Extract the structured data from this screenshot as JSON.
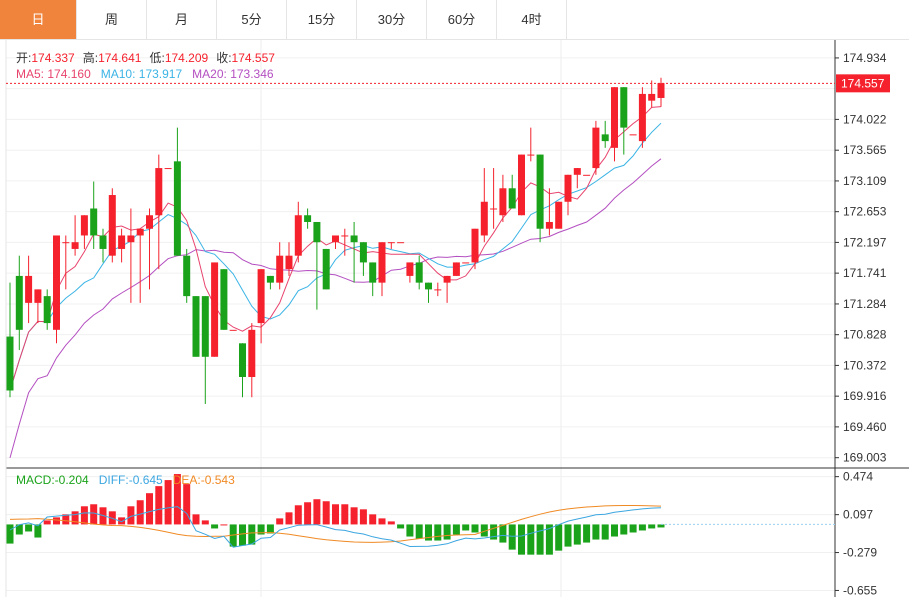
{
  "tabs": [
    {
      "label": "日",
      "active": true
    },
    {
      "label": "周",
      "active": false
    },
    {
      "label": "月",
      "active": false
    },
    {
      "label": "5分",
      "active": false
    },
    {
      "label": "15分",
      "active": false
    },
    {
      "label": "30分",
      "active": false
    },
    {
      "label": "60分",
      "active": false
    },
    {
      "label": "4时",
      "active": false
    }
  ],
  "ohlc_info": {
    "open_label": "开:",
    "open": "174.337",
    "high_label": "高:",
    "high": "174.641",
    "low_label": "低:",
    "low": "174.209",
    "close_label": "收:",
    "close": "174.557"
  },
  "ma_info": {
    "ma5_label": "MA5:",
    "ma5": "174.160",
    "ma10_label": "MA10:",
    "ma10": "173.917",
    "ma20_label": "MA20:",
    "ma20": "173.346"
  },
  "macd_info": {
    "macd_label": "MACD:",
    "macd": "-0.204",
    "diff_label": "DIFF:",
    "diff": "-0.645",
    "dea_label": "DEA:",
    "dea": "-0.543"
  },
  "colors": {
    "up": "#f5222d",
    "down": "#1aa31a",
    "ma5": "#e8436d",
    "ma10": "#3bb4e5",
    "ma20": "#b44fc1",
    "dea": "#f08a24",
    "diff": "#3ba6e0",
    "accent": "#f0843c"
  },
  "chart_data": [
    {
      "type": "candlestick",
      "ylim": [
        168.85,
        175.2
      ],
      "y_ticks": [
        "174.934",
        "174.478",
        "174.022",
        "173.565",
        "173.109",
        "172.653",
        "172.197",
        "171.741",
        "171.284",
        "170.828",
        "170.372",
        "169.916",
        "169.460",
        "169.003"
      ],
      "last_price": "174.557",
      "candles": [
        [
          170.8,
          171.6,
          169.9,
          170.0
        ],
        [
          171.7,
          172.0,
          170.6,
          170.9
        ],
        [
          171.3,
          172.0,
          171.0,
          171.7
        ],
        [
          171.3,
          171.5,
          171.0,
          171.5
        ],
        [
          171.4,
          171.5,
          170.9,
          171.0
        ],
        [
          170.9,
          172.3,
          170.7,
          172.3
        ],
        [
          172.2,
          172.3,
          171.5,
          172.2
        ],
        [
          172.1,
          172.6,
          172.0,
          172.2
        ],
        [
          172.3,
          172.6,
          172.1,
          172.6
        ],
        [
          172.7,
          173.1,
          172.1,
          172.3
        ],
        [
          172.3,
          172.4,
          171.9,
          172.1
        ],
        [
          172.0,
          173.0,
          171.9,
          172.9
        ],
        [
          172.1,
          172.4,
          171.9,
          172.3
        ],
        [
          172.2,
          172.7,
          171.3,
          172.3
        ],
        [
          172.3,
          172.4,
          171.3,
          172.4
        ],
        [
          172.4,
          172.7,
          171.5,
          172.6
        ],
        [
          172.6,
          173.5,
          171.8,
          173.3
        ],
        [
          173.3,
          173.3,
          173.3,
          173.3
        ],
        [
          173.4,
          173.9,
          172.0,
          172.0
        ],
        [
          172.0,
          172.1,
          171.3,
          171.4
        ],
        [
          171.4,
          171.4,
          170.5,
          170.5
        ],
        [
          171.4,
          171.4,
          169.8,
          170.5
        ],
        [
          170.5,
          171.9,
          170.5,
          171.9
        ],
        [
          171.8,
          171.8,
          170.9,
          170.9
        ],
        [
          170.9,
          170.9,
          170.9,
          170.9
        ],
        [
          170.7,
          170.7,
          169.9,
          170.2
        ],
        [
          170.2,
          171.0,
          169.9,
          170.9
        ],
        [
          171.0,
          171.8,
          170.7,
          171.8
        ],
        [
          171.7,
          171.7,
          171.5,
          171.6
        ],
        [
          171.6,
          172.2,
          171.5,
          172.0
        ],
        [
          171.8,
          172.2,
          171.7,
          172.0
        ],
        [
          172.0,
          172.8,
          171.9,
          172.6
        ],
        [
          172.6,
          172.7,
          172.4,
          172.5
        ],
        [
          172.5,
          172.5,
          171.2,
          172.2
        ],
        [
          172.1,
          172.1,
          171.5,
          171.5
        ],
        [
          172.2,
          172.3,
          172.1,
          172.3
        ],
        [
          172.3,
          172.4,
          172.0,
          172.3
        ],
        [
          172.3,
          172.5,
          171.6,
          172.2
        ],
        [
          172.2,
          172.2,
          171.7,
          171.9
        ],
        [
          171.9,
          171.9,
          171.4,
          171.6
        ],
        [
          171.6,
          172.2,
          171.4,
          172.2
        ],
        [
          172.2,
          172.2,
          172.1,
          172.2
        ],
        [
          172.2,
          172.2,
          172.2,
          172.2
        ],
        [
          171.7,
          171.9,
          171.6,
          171.9
        ],
        [
          171.9,
          172.0,
          171.5,
          171.6
        ],
        [
          171.6,
          171.6,
          171.3,
          171.5
        ],
        [
          171.5,
          171.6,
          171.4,
          171.5
        ],
        [
          171.6,
          171.7,
          171.3,
          171.7
        ],
        [
          171.7,
          171.9,
          171.7,
          171.9
        ],
        [
          171.9,
          171.9,
          171.9,
          171.9
        ],
        [
          171.9,
          172.4,
          171.8,
          172.4
        ],
        [
          172.3,
          173.3,
          172.2,
          172.8
        ],
        [
          172.7,
          173.3,
          172.4,
          172.7
        ],
        [
          172.6,
          173.2,
          172.5,
          173.0
        ],
        [
          173.0,
          173.2,
          172.7,
          172.7
        ],
        [
          172.6,
          173.5,
          172.6,
          173.5
        ],
        [
          173.5,
          173.9,
          173.4,
          173.5
        ],
        [
          173.5,
          173.5,
          172.2,
          172.4
        ],
        [
          172.4,
          173.0,
          172.3,
          172.5
        ],
        [
          172.4,
          172.8,
          172.4,
          172.8
        ],
        [
          172.8,
          173.2,
          172.6,
          173.2
        ],
        [
          173.2,
          173.3,
          173.0,
          173.3
        ],
        [
          173.2,
          173.2,
          173.2,
          173.2
        ],
        [
          173.3,
          174.0,
          173.2,
          173.9
        ],
        [
          173.8,
          174.0,
          173.6,
          173.7
        ],
        [
          173.6,
          174.5,
          173.4,
          174.5
        ],
        [
          174.5,
          174.5,
          173.5,
          173.9
        ],
        [
          173.8,
          173.8,
          173.8,
          173.8
        ],
        [
          173.7,
          174.5,
          173.6,
          174.4
        ],
        [
          174.3,
          174.6,
          174.2,
          174.4
        ],
        [
          174.34,
          174.64,
          174.21,
          174.56
        ]
      ]
    },
    {
      "type": "macd",
      "ylim": [
        -0.72,
        0.54
      ],
      "y_ticks": [
        "0.474",
        "0.097",
        "-0.279",
        "-0.655"
      ],
      "histogram": [
        -0.19,
        -0.1,
        -0.07,
        -0.13,
        0.04,
        0.07,
        0.1,
        0.13,
        0.18,
        0.2,
        0.17,
        0.13,
        0.07,
        0.18,
        0.24,
        0.31,
        0.38,
        0.44,
        0.5,
        0.4,
        0.1,
        0.04,
        -0.04,
        0.0,
        -0.22,
        -0.21,
        -0.2,
        -0.1,
        -0.09,
        0.06,
        0.12,
        0.19,
        0.22,
        0.25,
        0.23,
        0.2,
        0.2,
        0.17,
        0.15,
        0.1,
        0.06,
        0.03,
        -0.04,
        -0.12,
        -0.14,
        -0.16,
        -0.16,
        -0.15,
        -0.1,
        -0.06,
        -0.08,
        -0.12,
        -0.15,
        -0.18,
        -0.25,
        -0.3,
        -0.3,
        -0.3,
        -0.3,
        -0.26,
        -0.22,
        -0.2,
        -0.18,
        -0.15,
        -0.15,
        -0.12,
        -0.1,
        -0.08,
        -0.06,
        -0.04,
        -0.03
      ]
    }
  ]
}
